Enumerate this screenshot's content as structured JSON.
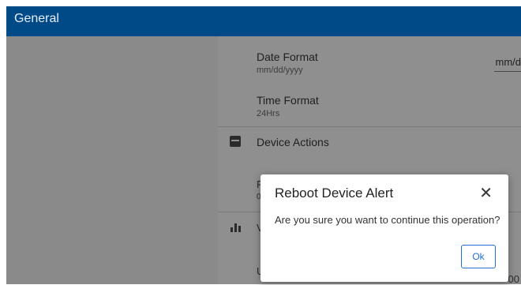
{
  "appbar": {
    "title": "General"
  },
  "settings": {
    "date_format": {
      "label": "Date Format",
      "value": "mm/dd/yyyy",
      "field_value": "mm/d"
    },
    "time_format": {
      "label": "Time Format",
      "value": "24Hrs"
    },
    "device_actions": {
      "label": "Device Actions"
    },
    "partial_letter_1": "F",
    "partial_letter_2": "0",
    "partial_letter_3": "V",
    "partial_letter_4": "U",
    "partial_right_value": "00"
  },
  "dialog": {
    "title": "Reboot Device Alert",
    "message": "Are you sure you want to continue this operation?",
    "ok_label": "Ok",
    "close_glyph": "✕"
  }
}
